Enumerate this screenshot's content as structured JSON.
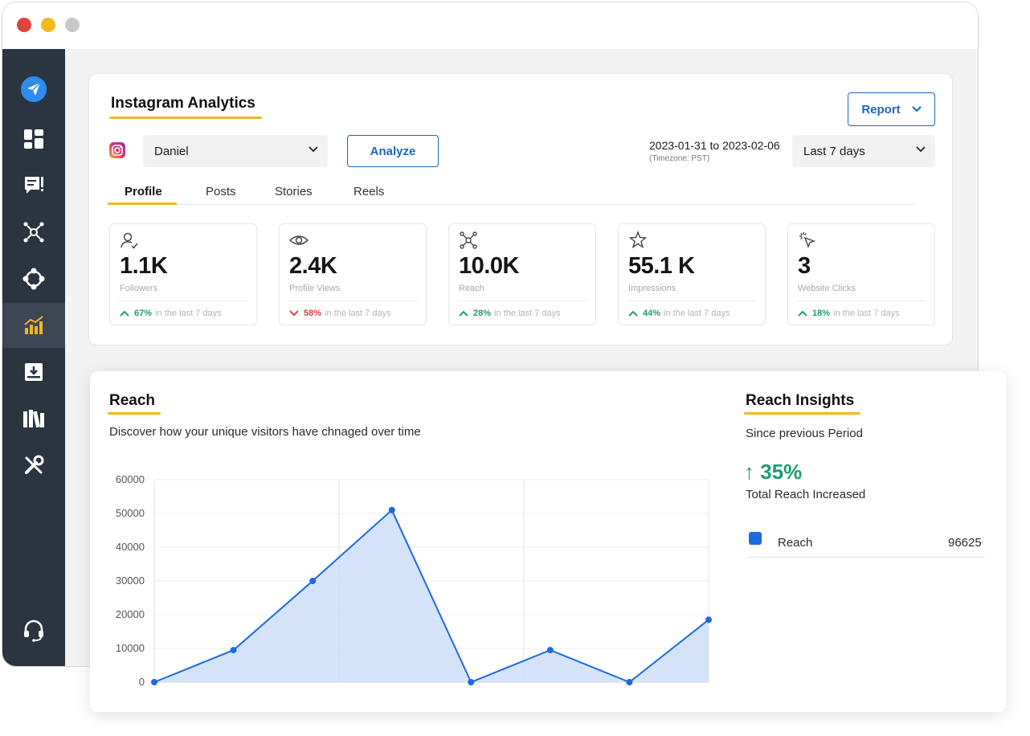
{
  "header": {
    "title": "Instagram Analytics",
    "report_label": "Report",
    "account_select": "Daniel",
    "analyze_label": "Analyze",
    "date_range": "2023-01-31 to 2023-02-06",
    "timezone": "(Timezone: PST)",
    "period_select": "Last 7 days"
  },
  "sidebar": {
    "items": [
      {
        "icon": "paper-plane-icon"
      },
      {
        "icon": "dashboard-icon"
      },
      {
        "icon": "message-icon"
      },
      {
        "icon": "network-icon"
      },
      {
        "icon": "orbit-icon"
      },
      {
        "icon": "analytics-icon",
        "active": true
      },
      {
        "icon": "inbox-download-icon"
      },
      {
        "icon": "library-icon"
      },
      {
        "icon": "tools-icon"
      },
      {
        "icon": "headset-icon"
      }
    ]
  },
  "tabs": [
    {
      "label": "Profile",
      "active": true
    },
    {
      "label": "Posts"
    },
    {
      "label": "Stories"
    },
    {
      "label": "Reels"
    }
  ],
  "metrics": [
    {
      "icon": "user-check-icon",
      "value": "1.1K",
      "label": "Followers",
      "change": "67%",
      "trend": "up",
      "suffix": "in the last 7 days"
    },
    {
      "icon": "eye-icon",
      "value": "2.4K",
      "label": "Profile Views",
      "change": "58%",
      "trend": "down",
      "suffix": "in the last 7 days"
    },
    {
      "icon": "network-icon",
      "value": "10.0K",
      "label": "Reach",
      "change": "28%",
      "trend": "up",
      "suffix": "in the last 7 days"
    },
    {
      "icon": "star-icon",
      "value": "55.1 K",
      "label": "Impressions",
      "change": "44%",
      "trend": "up",
      "suffix": "in the last 7 days"
    },
    {
      "icon": "cursor-click-icon",
      "value": "3",
      "label": "Website Clicks",
      "change": "18%",
      "trend": "up",
      "suffix": "in the last 7 days"
    }
  ],
  "reach": {
    "title": "Reach",
    "subtitle": "Discover how your unique visitors have chnaged over time"
  },
  "insights": {
    "title": "Reach Insights",
    "since": "Since previous Period",
    "arrow": "↑",
    "percent": "35%",
    "caption": "Total Reach Increased",
    "legend_label": "Reach",
    "legend_value": "96625"
  },
  "colors": {
    "accent": "#1a66c4",
    "underline": "#f3b61f",
    "sidebar": "#2b3441",
    "line": "#1d6ae0",
    "area": "#cfe0f7",
    "up": "#1f9e6e",
    "down": "#d24646"
  },
  "chart_data": {
    "type": "area",
    "x": [
      0,
      1,
      2,
      3,
      4,
      5,
      6,
      7
    ],
    "values": [
      0,
      9500,
      30000,
      51000,
      0,
      9500,
      0,
      18500
    ],
    "yticks": [
      "0",
      "10000",
      "20000",
      "30000",
      "40000",
      "50000",
      "60000"
    ],
    "ylim": [
      0,
      60000
    ],
    "title": "",
    "xlabel": "",
    "ylabel": "",
    "grid": true
  }
}
